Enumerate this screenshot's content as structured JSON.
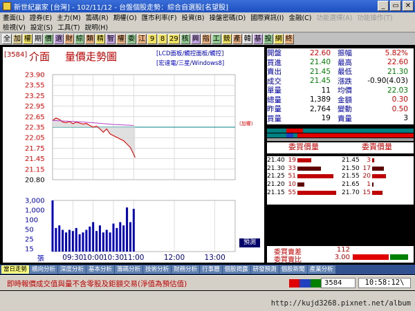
{
  "window": {
    "title": "新世紀贏家 [台灣] - 102/11/12 - 台盤個股走勢：綜合自選股[名望股]",
    "min": "_",
    "max": "▭",
    "close": "✕"
  },
  "menu": {
    "row1": [
      "畫面(L)",
      "證券(E)",
      "主力(M)",
      "籌碼(R)",
      "期權(O)",
      "匯市利率(F)",
      "投資(B)",
      "操盤密碼(D)",
      "國際資訊(I)",
      "金融(C)",
      "功能選擇(A)",
      "功能操作(T)"
    ],
    "row2": [
      "檢視(V)",
      "設定(S)",
      "工具(T)",
      "說明(H)"
    ]
  },
  "toolbar": [
    "全",
    "加",
    "權",
    "期",
    "價",
    "選",
    "財",
    "綜",
    "類",
    "精",
    "智",
    "權",
    "委",
    "江",
    "9",
    "8",
    "29",
    "核",
    "興",
    "指",
    "工",
    "競",
    "產",
    "韓",
    "基",
    "投",
    "網",
    "終"
  ],
  "stock": {
    "code": "[3584]",
    "name": "介面",
    "chart_title": "量價走勢圖",
    "sub_line1": "[LCD面板/觸控面板/觸控]",
    "sub_line2": "[宏達電/三星/Windows8]",
    "avg_label": "(加權)",
    "forecast": "預測"
  },
  "chart_data": {
    "type": "line",
    "title": "量價走勢圖",
    "price_ticks": [
      "23.90",
      "23.55",
      "23.25",
      "22.95",
      "22.65",
      "22.35",
      "22.05",
      "21.75",
      "21.45",
      "21.15",
      "20.80"
    ],
    "price_ylim": [
      20.8,
      23.9
    ],
    "ref_price": 22.35,
    "volume_ticks": [
      "3,000",
      "1,000",
      "100",
      "50",
      "25",
      "15",
      "張"
    ],
    "time_labels": [
      "09:30",
      "10:00",
      "10:30",
      "11:00",
      "12:00",
      "13:00"
    ],
    "time_range": [
      "09:00",
      "13:30"
    ],
    "price_series": {
      "x": [
        "09:00",
        "09:05",
        "09:10",
        "09:15",
        "09:20",
        "09:25",
        "09:30",
        "09:35",
        "09:40",
        "09:45",
        "09:50",
        "09:55",
        "10:00",
        "10:05",
        "10:10",
        "10:15",
        "10:20",
        "10:25",
        "10:30",
        "10:35",
        "10:40",
        "10:45",
        "10:50",
        "10:55",
        "11:00",
        "11:02"
      ],
      "y": [
        22.55,
        22.62,
        22.58,
        22.5,
        22.48,
        22.52,
        22.45,
        22.5,
        22.47,
        22.44,
        22.46,
        22.4,
        22.35,
        22.38,
        22.3,
        22.2,
        22.3,
        22.15,
        22.1,
        22.05,
        22.0,
        21.95,
        21.85,
        21.75,
        21.55,
        21.45
      ]
    },
    "average_series": {
      "x": [
        "09:00",
        "09:30",
        "10:00",
        "10:30",
        "11:00"
      ],
      "y": [
        22.55,
        22.52,
        22.48,
        22.43,
        22.4
      ]
    },
    "volume_series": {
      "x": [
        "09:00",
        "09:05",
        "09:10",
        "09:15",
        "09:20",
        "09:25",
        "09:30",
        "09:35",
        "09:40",
        "09:45",
        "09:50",
        "09:55",
        "10:00",
        "10:05",
        "10:10",
        "10:15",
        "10:20",
        "10:25",
        "10:30",
        "10:35",
        "10:40",
        "10:45",
        "10:50",
        "10:55",
        "11:00"
      ],
      "y": [
        3000,
        40,
        60,
        30,
        20,
        30,
        25,
        40,
        15,
        20,
        30,
        50,
        100,
        25,
        60,
        20,
        30,
        20,
        80,
        40,
        100,
        60,
        1000,
        100,
        800
      ]
    },
    "grid": true
  },
  "quote": {
    "rows": [
      {
        "l1": "開盤",
        "v1": "22.60",
        "c1": "red",
        "l2": "振幅",
        "v2": "5.82%",
        "c2": "red"
      },
      {
        "l1": "買進",
        "v1": "21.40",
        "c1": "green",
        "l2": "最高",
        "v2": "22.60",
        "c2": "red"
      },
      {
        "l1": "賣出",
        "v1": "21.45",
        "c1": "green",
        "l2": "最低",
        "v2": "21.30",
        "c2": "green"
      },
      {
        "l1": "成交",
        "v1": "21.45",
        "c1": "green",
        "l2": "漲跌",
        "v2": "-0.90(4.03)",
        "c2": "blk"
      },
      {
        "l1": "單量",
        "v1": "11",
        "c1": "blk",
        "l2": "均價",
        "v2": "22.03",
        "c2": "green"
      },
      {
        "l1": "總量",
        "v1": "1,389",
        "c1": "blk",
        "l2": "金額",
        "v2": "0.30",
        "c2": "red"
      },
      {
        "l1": "昨量",
        "v1": "2,764",
        "c1": "blk",
        "l2": "變動",
        "v2": "0.50",
        "c2": "red"
      },
      {
        "l1": "買量",
        "v1": "19",
        "c1": "blk",
        "l2": "賣量",
        "v2": "3",
        "c2": "blk"
      }
    ]
  },
  "depth": {
    "bid_header": "委買價量",
    "ask_header": "委賣價量",
    "bids": [
      {
        "p": "21.40",
        "q": "19",
        "w": 0.35
      },
      {
        "p": "21.30",
        "q": "33",
        "w": 0.6
      },
      {
        "p": "21.25",
        "q": "51",
        "w": 0.92
      },
      {
        "p": "21.20",
        "q": "10",
        "w": 0.18
      },
      {
        "p": "21.15",
        "q": "55",
        "w": 1.0
      }
    ],
    "asks": [
      {
        "p": "21.45",
        "q": "3",
        "w": 0.06
      },
      {
        "p": "21.50",
        "q": "17",
        "w": 0.31
      },
      {
        "p": "21.55",
        "q": "20",
        "w": 0.36
      },
      {
        "p": "21.65",
        "q": "1",
        "w": 0.02
      },
      {
        "p": "21.70",
        "q": "15",
        "w": 0.27
      }
    ],
    "diff_label": "委買賣差",
    "diff_value": "112",
    "ratio_label": "委買賣比",
    "ratio_value": "3.00"
  },
  "tabs": [
    "當日走勢",
    "橫向分析",
    "深度分析",
    "基本分析",
    "籌碼分析",
    "技術分析",
    "財務分析",
    "行事曆",
    "個股揭露",
    "研發預測",
    "個股新聞",
    "產業分析"
  ],
  "status": {
    "message": "即時報價成交值與量不含零股及鉅額交易(淨值為預估值)",
    "code": "3584",
    "time": "10:58:12\\"
  },
  "watermark": "http://kujd3268.pixnet.net/album",
  "colors": {
    "up": "#e00000",
    "down": "#008000",
    "accent": "#c00000",
    "volume": "#0000c0"
  }
}
